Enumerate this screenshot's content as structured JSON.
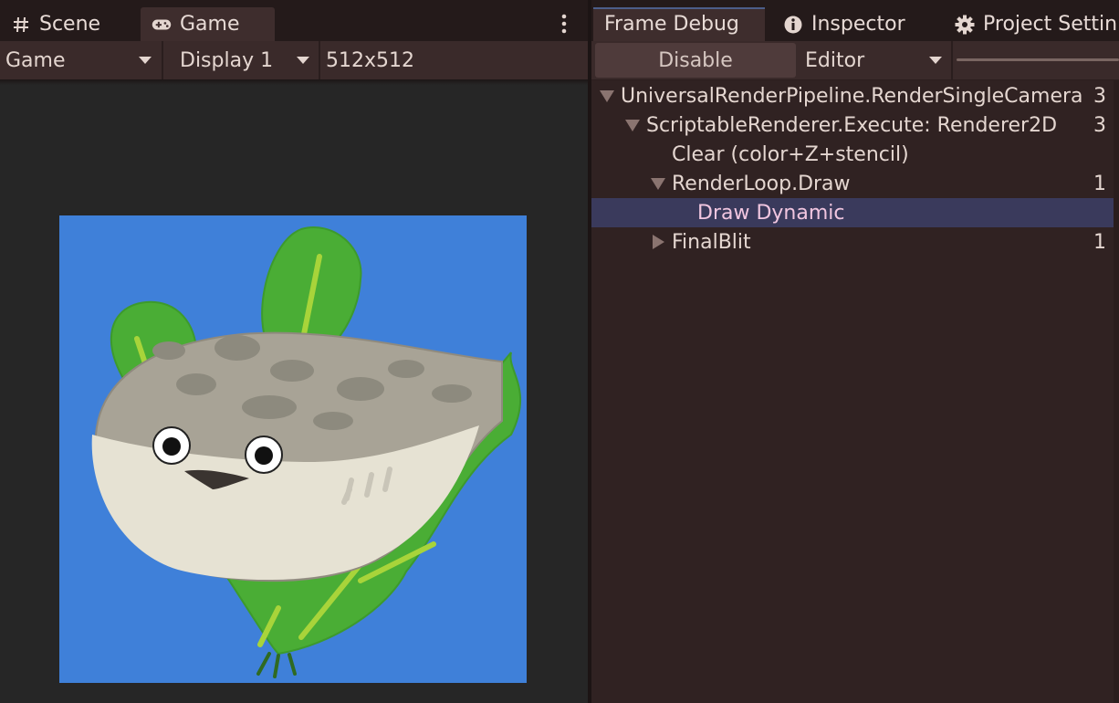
{
  "left_panel": {
    "tabs": [
      {
        "label": "Scene",
        "icon": "hash-grid-icon"
      },
      {
        "label": "Game",
        "icon": "gamepad-icon",
        "active": true
      }
    ],
    "more_menu_icon": "kebab-menu-icon",
    "toolbar": {
      "mode_label": "Game",
      "display_label": "Display 1",
      "resolution_label": "512x512"
    }
  },
  "right_panel": {
    "tabs": [
      {
        "label": "Frame Debug",
        "active": true
      },
      {
        "label": "Inspector",
        "icon": "info-icon"
      },
      {
        "label": "Project Settin",
        "icon": "gear-icon"
      }
    ],
    "toolbar": {
      "disable_label": "Disable",
      "target_label": "Editor"
    },
    "tree": [
      {
        "label": "UniversalRenderPipeline.RenderSingleCamera",
        "count": "3",
        "level": 0,
        "expanded": true
      },
      {
        "label": "ScriptableRenderer.Execute: Renderer2D",
        "count": "3",
        "level": 1,
        "expanded": true
      },
      {
        "label": "Clear (color+Z+stencil)",
        "count": "",
        "level": 2
      },
      {
        "label": "RenderLoop.Draw",
        "count": "1",
        "level": 2,
        "expanded": true
      },
      {
        "label": "Draw Dynamic",
        "count": "",
        "level": 3,
        "selected": true
      },
      {
        "label": "FinalBlit",
        "count": "1",
        "level": 2,
        "expanded": false
      }
    ]
  },
  "colors": {
    "game_background": "#3f80d9",
    "selection": "#3a3a5c",
    "leaf_green": "#4aad35",
    "fish_grey": "#a8a396",
    "fish_belly": "#e6e2d3"
  }
}
